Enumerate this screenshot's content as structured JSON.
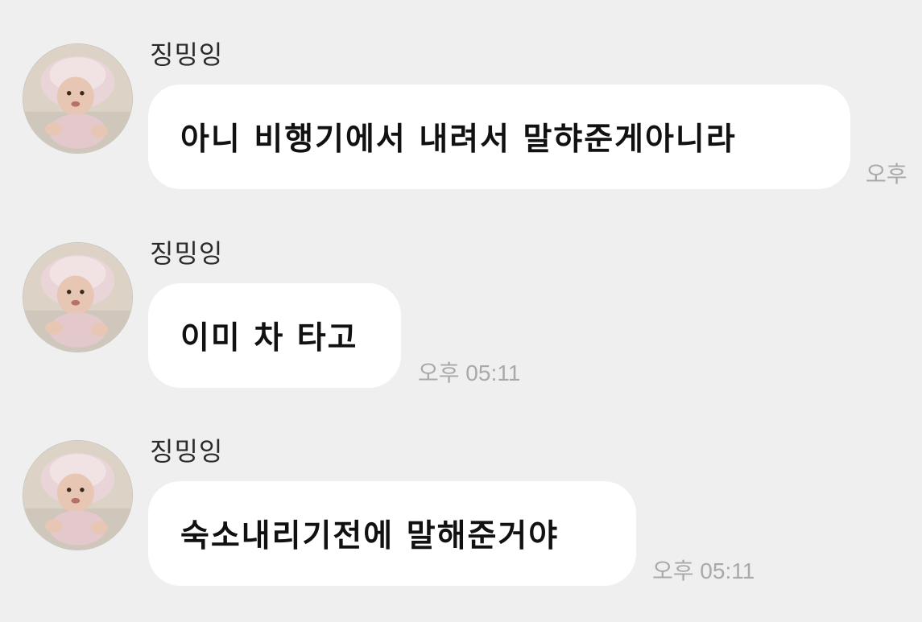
{
  "messages": [
    {
      "sender": "징밍잉",
      "text": "아니 비행기에서 내려서 말햐준게아니라",
      "time": "오후"
    },
    {
      "sender": "징밍잉",
      "text": "이미 차 타고",
      "time": "오후 05:11"
    },
    {
      "sender": "징밍잉",
      "text": "숙소내리기전에 말해준거야",
      "time": "오후 05:11"
    }
  ],
  "colors": {
    "background": "#efefef",
    "bubble": "#ffffff",
    "timestamp": "#a9a9a9"
  },
  "icons": {
    "avatar": "profile-photo-baby-in-bonnet"
  }
}
